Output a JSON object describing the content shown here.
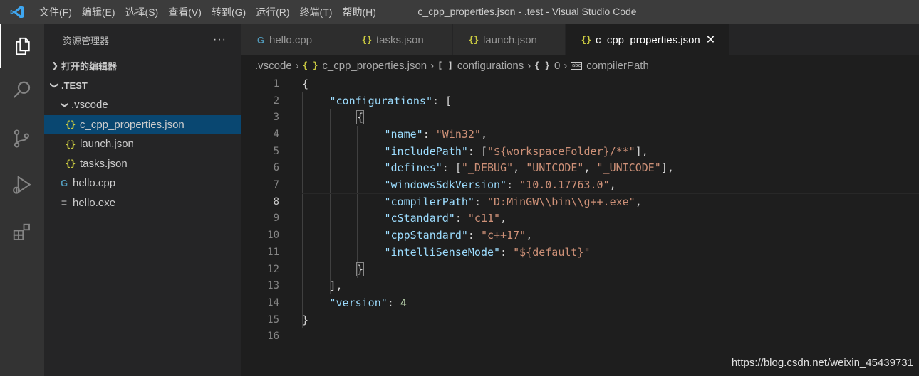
{
  "window": {
    "title": "c_cpp_properties.json - .test - Visual Studio Code"
  },
  "menu": [
    "文件(F)",
    "编辑(E)",
    "选择(S)",
    "查看(V)",
    "转到(G)",
    "运行(R)",
    "终端(T)",
    "帮助(H)"
  ],
  "activity_bar": [
    "files-icon",
    "search-icon",
    "source-control-icon",
    "run-debug-icon",
    "extensions-icon"
  ],
  "sidebar": {
    "title": "资源管理器",
    "more": "···",
    "open_editors": "打开的编辑器",
    "folder": ".TEST",
    "subfolder": ".vscode",
    "files": [
      {
        "name": "c_cpp_properties.json",
        "icon": "json-icon"
      },
      {
        "name": "launch.json",
        "icon": "json-icon"
      },
      {
        "name": "tasks.json",
        "icon": "json-icon"
      },
      {
        "name": "hello.cpp",
        "icon": "cpp-icon"
      },
      {
        "name": "hello.exe",
        "icon": "exe-icon"
      }
    ]
  },
  "tabs": [
    {
      "label": "hello.cpp",
      "icon": "cpp-icon"
    },
    {
      "label": "tasks.json",
      "icon": "json-icon"
    },
    {
      "label": "launch.json",
      "icon": "json-icon"
    },
    {
      "label": "c_cpp_properties.json",
      "icon": "json-icon",
      "active": true
    }
  ],
  "breadcrumbs": {
    "folder": ".vscode",
    "file": "c_cpp_properties.json",
    "array": "configurations",
    "object": "0",
    "property": "compilerPath",
    "array_icon": "[ ]",
    "object_icon": "{ }",
    "json_icon": "{ }"
  },
  "editor": {
    "current_line": 8,
    "lines": [
      {
        "n": "1",
        "t": [
          [
            "punc",
            "{"
          ]
        ]
      },
      {
        "n": "2",
        "t": [
          [
            "key",
            "\"configurations\""
          ],
          [
            "punc",
            ": ["
          ]
        ]
      },
      {
        "n": "3",
        "t": [
          [
            "punc",
            "{"
          ]
        ]
      },
      {
        "n": "4",
        "t": [
          [
            "key",
            "\"name\""
          ],
          [
            "punc",
            ": "
          ],
          [
            "str",
            "\"Win32\""
          ],
          [
            "punc",
            ","
          ]
        ]
      },
      {
        "n": "5",
        "t": [
          [
            "key",
            "\"includePath\""
          ],
          [
            "punc",
            ": ["
          ],
          [
            "str",
            "\"${workspaceFolder}/**\""
          ],
          [
            "punc",
            "],"
          ]
        ]
      },
      {
        "n": "6",
        "t": [
          [
            "key",
            "\"defines\""
          ],
          [
            "punc",
            ": ["
          ],
          [
            "str",
            "\"_DEBUG\""
          ],
          [
            "punc",
            ", "
          ],
          [
            "str",
            "\"UNICODE\""
          ],
          [
            "punc",
            ", "
          ],
          [
            "str",
            "\"_UNICODE\""
          ],
          [
            "punc",
            "],"
          ]
        ]
      },
      {
        "n": "7",
        "t": [
          [
            "key",
            "\"windowsSdkVersion\""
          ],
          [
            "punc",
            ": "
          ],
          [
            "str",
            "\"10.0.17763.0\""
          ],
          [
            "punc",
            ","
          ]
        ]
      },
      {
        "n": "8",
        "t": [
          [
            "key",
            "\"compilerPath\""
          ],
          [
            "punc",
            ": "
          ],
          [
            "str",
            "\"D:MinGW\\\\bin\\\\g++.exe\""
          ],
          [
            "punc",
            ","
          ]
        ]
      },
      {
        "n": "9",
        "t": [
          [
            "key",
            "\"cStandard\""
          ],
          [
            "punc",
            ": "
          ],
          [
            "str",
            "\"c11\""
          ],
          [
            "punc",
            ","
          ]
        ]
      },
      {
        "n": "10",
        "t": [
          [
            "key",
            "\"cppStandard\""
          ],
          [
            "punc",
            ": "
          ],
          [
            "str",
            "\"c++17\""
          ],
          [
            "punc",
            ","
          ]
        ]
      },
      {
        "n": "11",
        "t": [
          [
            "key",
            "\"intelliSenseMode\""
          ],
          [
            "punc",
            ": "
          ],
          [
            "str",
            "\"${default}\""
          ]
        ]
      },
      {
        "n": "12",
        "t": [
          [
            "punc",
            "}"
          ]
        ]
      },
      {
        "n": "13",
        "t": [
          [
            "punc",
            "],"
          ]
        ]
      },
      {
        "n": "14",
        "t": [
          [
            "key",
            "\"version\""
          ],
          [
            "punc",
            ": "
          ],
          [
            "num",
            "4"
          ]
        ]
      },
      {
        "n": "15",
        "t": [
          [
            "punc",
            "}"
          ]
        ]
      },
      {
        "n": "16",
        "t": []
      }
    ]
  },
  "watermark": "https://blog.csdn.net/weixin_45439731",
  "colors": {
    "accent": "#007acc",
    "json_icon": "#cbcb41",
    "cpp_icon": "#519aba",
    "selection": "#094771"
  }
}
